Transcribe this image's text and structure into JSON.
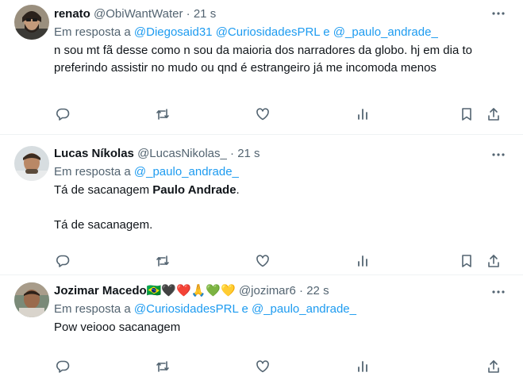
{
  "colors": {
    "link": "#1d9bf0",
    "secondary_text": "#536471",
    "primary_text": "#0f1419",
    "divider": "#eff3f4"
  },
  "tweets": [
    {
      "name": "renato",
      "handle": "@ObiWantWater",
      "dot": "·",
      "time": "21 s",
      "reply_prefix": "Em resposta a",
      "reply_mentions": [
        "@Diegosaid31",
        "@CuriosidadesPRL",
        "@_paulo_andrade_"
      ],
      "reply_joiner": "e",
      "text": "n sou mt fã desse como n sou da maioria dos narradores da globo. hj em dia to preferindo assistir no mudo ou qnd é estrangeiro já me incomoda menos"
    },
    {
      "name": "Lucas Níkolas",
      "handle": "@LucasNikolas_",
      "dot": "·",
      "time": "21 s",
      "reply_prefix": "Em resposta a",
      "reply_mentions": [
        "@_paulo_andrade_"
      ],
      "text_line1_a": "Tá de sacanagem ",
      "text_line1_bold": "Paulo Andrade",
      "text_line1_b": ".",
      "text_line2": "Tá de sacanagem."
    },
    {
      "name": "Jozimar Macedo",
      "name_emojis": "🇧🇷🖤❤️🙏💚💛",
      "handle": "@jozimar6",
      "dot": "·",
      "time": "22 s",
      "reply_prefix": "Em resposta a",
      "reply_mentions": [
        "@CuriosidadesPRL",
        "@_paulo_andrade_"
      ],
      "reply_joiner": "e",
      "text": "Pow veiooo sacanagem"
    }
  ],
  "icons": {
    "more": "more-dots-icon",
    "reply": "reply-bubble-icon",
    "retweet": "retweet-icon",
    "like": "heart-icon",
    "views": "analytics-bars-icon",
    "bookmark": "bookmark-icon",
    "share": "share-upload-icon"
  }
}
